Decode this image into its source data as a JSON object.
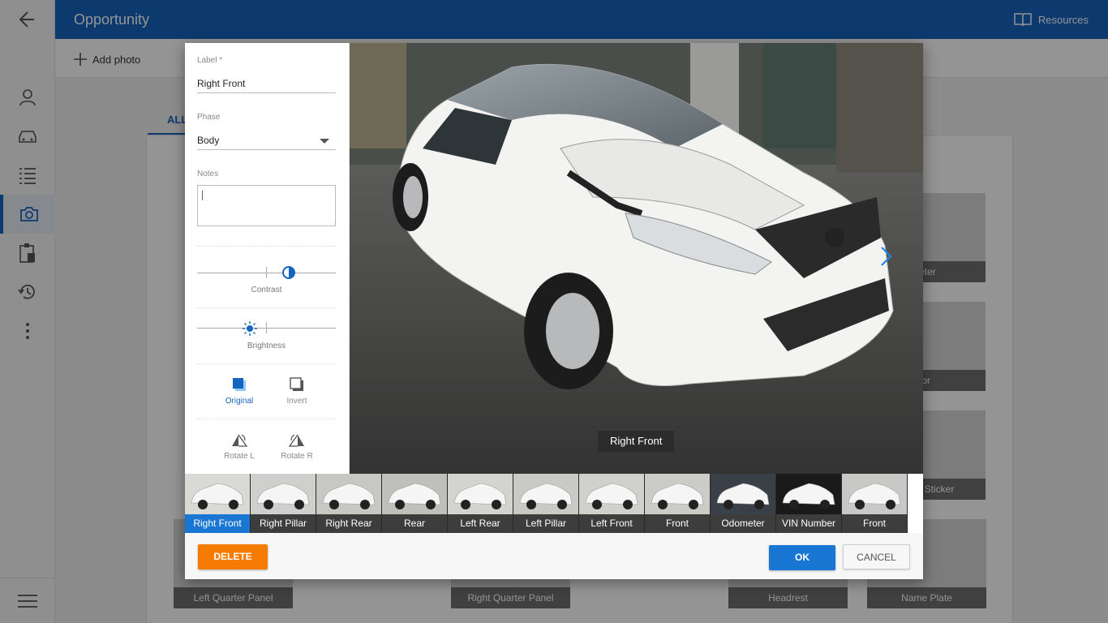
{
  "app": {
    "title": "Opportunity",
    "resources_label": "Resources"
  },
  "toolbar": {
    "add_photo_label": "Add photo"
  },
  "content": {
    "tab_all": "ALL",
    "tiles": [
      "meter",
      "erior",
      "ge Sticker",
      "Left Quarter Panel",
      "Right Quarter Panel",
      "Headrest",
      "Name Plate"
    ]
  },
  "editor": {
    "label_field": {
      "label": "Label *",
      "value": "Right Front"
    },
    "phase_field": {
      "label": "Phase",
      "value": "Body"
    },
    "notes_field": {
      "label": "Notes",
      "value": ""
    },
    "contrast_label": "Contrast",
    "contrast_level": 0.66,
    "brightness_label": "Brightness",
    "brightness_level": 0.38,
    "tools": {
      "original": "Original",
      "invert": "Invert",
      "rotate_l": "Rotate L",
      "rotate_r": "Rotate R"
    },
    "photo_caption": "Right Front",
    "thumbnails": [
      "Right Front",
      "Right Pillar",
      "Right Rear",
      "Rear",
      "Left Rear",
      "Left Pillar",
      "Left Front",
      "Front",
      "Odometer",
      "VIN Number",
      "Front"
    ],
    "selected_thumbnail": "Right Front",
    "buttons": {
      "delete": "DELETE",
      "ok": "OK",
      "cancel": "CANCEL"
    }
  },
  "colors": {
    "primary": "#1565c0",
    "accent": "#f57c00",
    "selected": "#1976d2"
  }
}
